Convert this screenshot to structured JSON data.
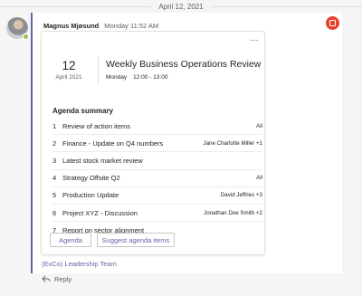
{
  "date_divider": "April 12, 2021",
  "message": {
    "sender": "Magnus Mjøsund",
    "timestamp": "Monday 11:52 AM",
    "team_link": "(ExCo) Leadership Team",
    "reply_label": "Reply"
  },
  "colors": {
    "accent": "#6264a7",
    "urgent": "#e8412a",
    "presence": "#92c353"
  },
  "card": {
    "more_label": "...",
    "day": "12",
    "month_year": "April 2021",
    "title": "Weekly Business Operations Review",
    "weekday": "Monday",
    "time_range": "12:00 - 13:00",
    "agenda_heading": "Agenda summary",
    "items": [
      {
        "num": "1",
        "text": "Review of action items",
        "owner": "All"
      },
      {
        "num": "2",
        "text": "Finance - Update on Q4 numbers",
        "owner": "Jane Charlotte Miller +1"
      },
      {
        "num": "3",
        "text": "Latest stock market review",
        "owner": ""
      },
      {
        "num": "4",
        "text": "Strategy Offsite Q2",
        "owner": "All"
      },
      {
        "num": "5",
        "text": "Production Update",
        "owner": "David Jeffries +3"
      },
      {
        "num": "6",
        "text": "Project XYZ - Discussion",
        "owner": "Jonathan Doe Smith +2"
      },
      {
        "num": "7",
        "text": "Report on sector alignment",
        "owner": ""
      }
    ],
    "buttons": {
      "agenda": "Agenda",
      "suggest": "Suggest agenda items"
    }
  }
}
